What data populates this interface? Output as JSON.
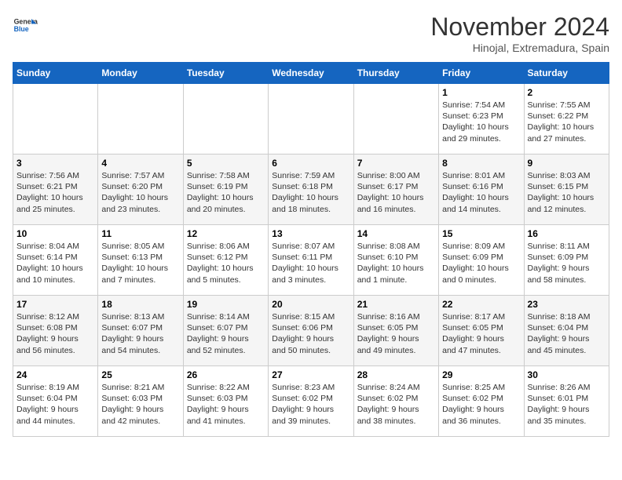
{
  "header": {
    "logo_general": "General",
    "logo_blue": "Blue",
    "month_title": "November 2024",
    "subtitle": "Hinojal, Extremadura, Spain"
  },
  "weekdays": [
    "Sunday",
    "Monday",
    "Tuesday",
    "Wednesday",
    "Thursday",
    "Friday",
    "Saturday"
  ],
  "weeks": [
    [
      {
        "day": "",
        "info": ""
      },
      {
        "day": "",
        "info": ""
      },
      {
        "day": "",
        "info": ""
      },
      {
        "day": "",
        "info": ""
      },
      {
        "day": "",
        "info": ""
      },
      {
        "day": "1",
        "info": "Sunrise: 7:54 AM\nSunset: 6:23 PM\nDaylight: 10 hours\nand 29 minutes."
      },
      {
        "day": "2",
        "info": "Sunrise: 7:55 AM\nSunset: 6:22 PM\nDaylight: 10 hours\nand 27 minutes."
      }
    ],
    [
      {
        "day": "3",
        "info": "Sunrise: 7:56 AM\nSunset: 6:21 PM\nDaylight: 10 hours\nand 25 minutes."
      },
      {
        "day": "4",
        "info": "Sunrise: 7:57 AM\nSunset: 6:20 PM\nDaylight: 10 hours\nand 23 minutes."
      },
      {
        "day": "5",
        "info": "Sunrise: 7:58 AM\nSunset: 6:19 PM\nDaylight: 10 hours\nand 20 minutes."
      },
      {
        "day": "6",
        "info": "Sunrise: 7:59 AM\nSunset: 6:18 PM\nDaylight: 10 hours\nand 18 minutes."
      },
      {
        "day": "7",
        "info": "Sunrise: 8:00 AM\nSunset: 6:17 PM\nDaylight: 10 hours\nand 16 minutes."
      },
      {
        "day": "8",
        "info": "Sunrise: 8:01 AM\nSunset: 6:16 PM\nDaylight: 10 hours\nand 14 minutes."
      },
      {
        "day": "9",
        "info": "Sunrise: 8:03 AM\nSunset: 6:15 PM\nDaylight: 10 hours\nand 12 minutes."
      }
    ],
    [
      {
        "day": "10",
        "info": "Sunrise: 8:04 AM\nSunset: 6:14 PM\nDaylight: 10 hours\nand 10 minutes."
      },
      {
        "day": "11",
        "info": "Sunrise: 8:05 AM\nSunset: 6:13 PM\nDaylight: 10 hours\nand 7 minutes."
      },
      {
        "day": "12",
        "info": "Sunrise: 8:06 AM\nSunset: 6:12 PM\nDaylight: 10 hours\nand 5 minutes."
      },
      {
        "day": "13",
        "info": "Sunrise: 8:07 AM\nSunset: 6:11 PM\nDaylight: 10 hours\nand 3 minutes."
      },
      {
        "day": "14",
        "info": "Sunrise: 8:08 AM\nSunset: 6:10 PM\nDaylight: 10 hours\nand 1 minute."
      },
      {
        "day": "15",
        "info": "Sunrise: 8:09 AM\nSunset: 6:09 PM\nDaylight: 10 hours\nand 0 minutes."
      },
      {
        "day": "16",
        "info": "Sunrise: 8:11 AM\nSunset: 6:09 PM\nDaylight: 9 hours\nand 58 minutes."
      }
    ],
    [
      {
        "day": "17",
        "info": "Sunrise: 8:12 AM\nSunset: 6:08 PM\nDaylight: 9 hours\nand 56 minutes."
      },
      {
        "day": "18",
        "info": "Sunrise: 8:13 AM\nSunset: 6:07 PM\nDaylight: 9 hours\nand 54 minutes."
      },
      {
        "day": "19",
        "info": "Sunrise: 8:14 AM\nSunset: 6:07 PM\nDaylight: 9 hours\nand 52 minutes."
      },
      {
        "day": "20",
        "info": "Sunrise: 8:15 AM\nSunset: 6:06 PM\nDaylight: 9 hours\nand 50 minutes."
      },
      {
        "day": "21",
        "info": "Sunrise: 8:16 AM\nSunset: 6:05 PM\nDaylight: 9 hours\nand 49 minutes."
      },
      {
        "day": "22",
        "info": "Sunrise: 8:17 AM\nSunset: 6:05 PM\nDaylight: 9 hours\nand 47 minutes."
      },
      {
        "day": "23",
        "info": "Sunrise: 8:18 AM\nSunset: 6:04 PM\nDaylight: 9 hours\nand 45 minutes."
      }
    ],
    [
      {
        "day": "24",
        "info": "Sunrise: 8:19 AM\nSunset: 6:04 PM\nDaylight: 9 hours\nand 44 minutes."
      },
      {
        "day": "25",
        "info": "Sunrise: 8:21 AM\nSunset: 6:03 PM\nDaylight: 9 hours\nand 42 minutes."
      },
      {
        "day": "26",
        "info": "Sunrise: 8:22 AM\nSunset: 6:03 PM\nDaylight: 9 hours\nand 41 minutes."
      },
      {
        "day": "27",
        "info": "Sunrise: 8:23 AM\nSunset: 6:02 PM\nDaylight: 9 hours\nand 39 minutes."
      },
      {
        "day": "28",
        "info": "Sunrise: 8:24 AM\nSunset: 6:02 PM\nDaylight: 9 hours\nand 38 minutes."
      },
      {
        "day": "29",
        "info": "Sunrise: 8:25 AM\nSunset: 6:02 PM\nDaylight: 9 hours\nand 36 minutes."
      },
      {
        "day": "30",
        "info": "Sunrise: 8:26 AM\nSunset: 6:01 PM\nDaylight: 9 hours\nand 35 minutes."
      }
    ]
  ]
}
